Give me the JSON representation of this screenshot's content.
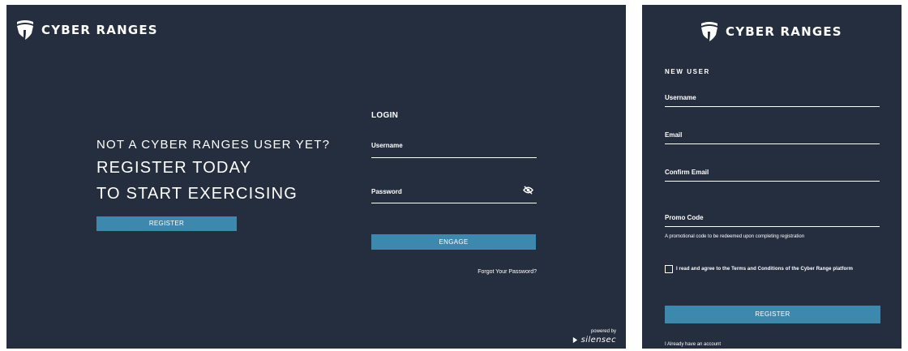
{
  "brand": {
    "name": "CYBER RANGES",
    "icon": "shield-logo-icon",
    "accent_color": "#3d88ad",
    "background_color": "#252e3e"
  },
  "promo": {
    "line1": "NOT A CYBER RANGES USER YET?",
    "line2": "REGISTER TODAY",
    "line3": "TO START EXERCISING",
    "register_label": "REGISTER"
  },
  "login": {
    "heading": "LOGIN",
    "username_label": "Username",
    "password_label": "Password",
    "password_toggle_icon": "eye-slash-icon",
    "submit_label": "ENGAGE",
    "forgot_label": "Forgot Your Password?"
  },
  "powered_by": {
    "label": "powered by",
    "brand": "silensec"
  },
  "register": {
    "heading": "NEW USER",
    "username_label": "Username",
    "email_label": "Email",
    "confirm_email_label": "Confirm Email",
    "promo_code_label": "Promo Code",
    "promo_hint": "A promotional code to be redeemed upon completing registration",
    "terms_text": "I read and agree to the Terms and Conditions of the Cyber Range platform",
    "submit_label": "REGISTER",
    "have_account_label": "I Already have an account"
  }
}
